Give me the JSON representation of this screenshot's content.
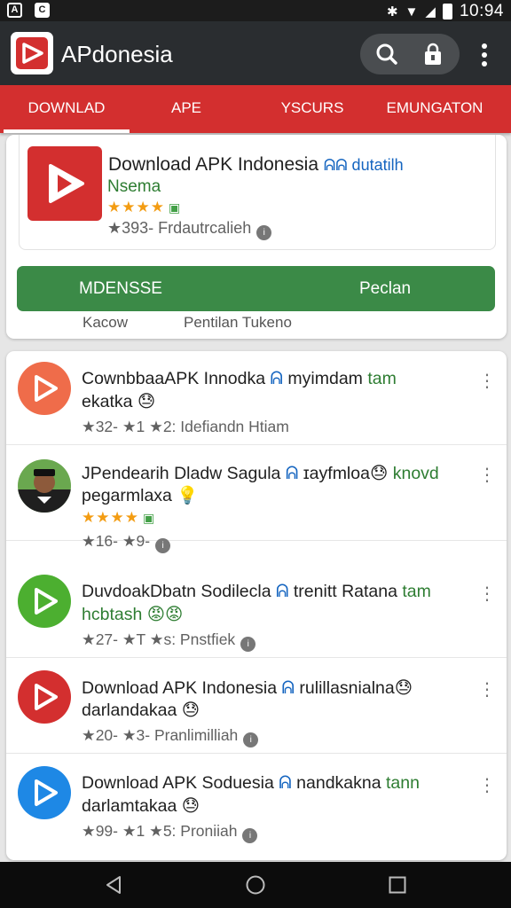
{
  "status_bar": {
    "time": "10:94"
  },
  "app_bar": {
    "title": "APdonesia",
    "icons": [
      "search-icon",
      "lock-icon",
      "more-vert-icon"
    ]
  },
  "tabs": [
    {
      "label": "DOWNLAD",
      "active": true
    },
    {
      "label": "APE"
    },
    {
      "label": "YSCURS"
    },
    {
      "label": "EMUNGATON"
    }
  ],
  "featured": {
    "title": "Download APK Indonesia",
    "title_suffix": "ᕱᕱ dutatilh",
    "subtitle": "Nsema",
    "stars": "★★★★",
    "meta": "★393- Frdautrcalieh",
    "button_left": "MDENSSE",
    "button_right": "Peclan",
    "sub_left": "Kacow",
    "sub_right": "Pentilan Tukeno"
  },
  "list": [
    {
      "title": "CownbbaaAPK Innodka",
      "tag": "myimdam",
      "extra": "tam",
      "line2": "ekatka 😓",
      "meta": "★32- ★1  ★2: Idefiandn Htiam",
      "icon_color": "#ef6c4a"
    },
    {
      "title": "JPendearih Dladw Sagula",
      "tag": "ɪayfmloa😓",
      "extra": "knovd",
      "line2": "pegarmlaxa 💡",
      "stars": "★★★★",
      "meta": "★16- ★9-",
      "icon_color": "#3a3a3a"
    },
    {
      "title": "DuvdoakDbatn Sodilecla",
      "tag": "trenitt Ratana",
      "extra": "tam",
      "line2": "hcbtash 😡😡",
      "meta": "★27- ★T  ★s: Pnstfiek",
      "icon_color": "#4caf30"
    },
    {
      "title": "Download APK Indonesia",
      "tag": "rulillasnialna😓",
      "extra": "",
      "line2": "darlandakaa 😓",
      "meta": "★20- ★3- Pranlimilliah",
      "icon_color": "#d32f2f"
    },
    {
      "title": "Download APK Soduesia",
      "tag": "nandkakna",
      "extra": "tann",
      "line2": "darlamtakaa 😓",
      "meta": "★99- ★1  ★5: Proniiah",
      "icon_color": "#1e88e5"
    }
  ],
  "colors": {
    "accent": "#d32f2f",
    "install": "#3b8a47",
    "link": "#2e7d32"
  }
}
